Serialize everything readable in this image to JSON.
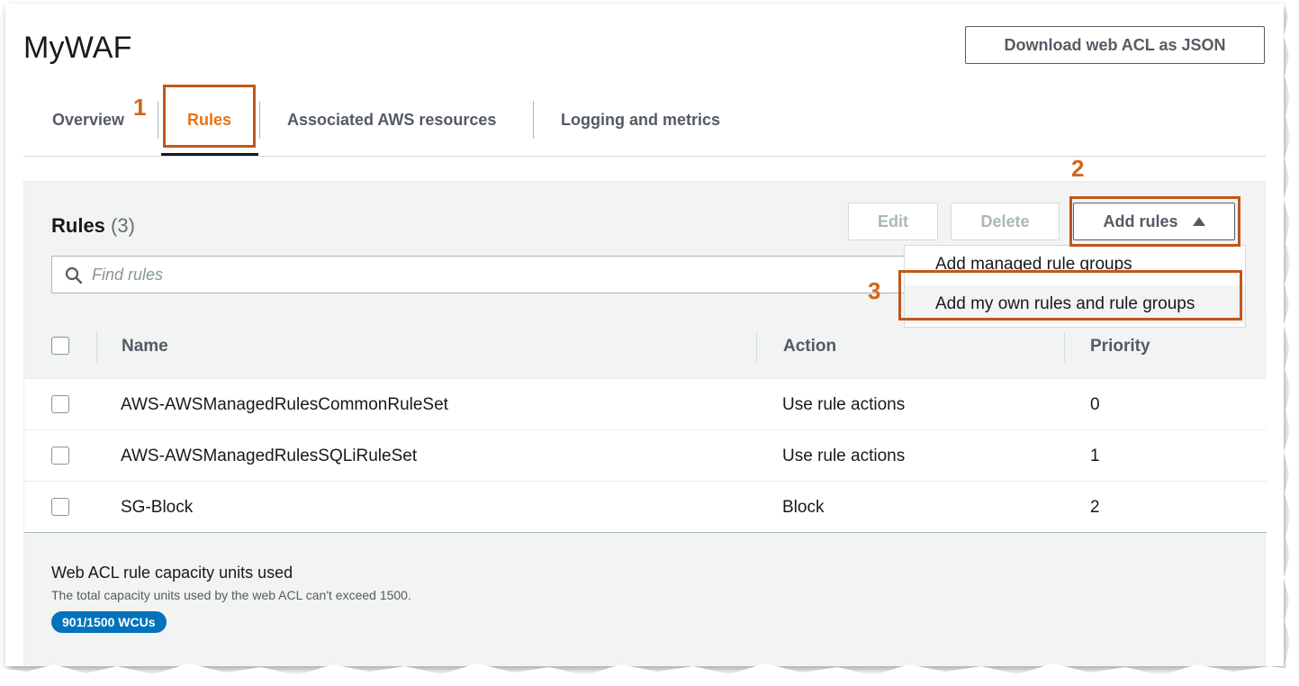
{
  "header": {
    "title": "MyWAF",
    "download_button": "Download web ACL as JSON"
  },
  "tabs": [
    {
      "label": "Overview"
    },
    {
      "label": "Rules"
    },
    {
      "label": "Associated AWS resources"
    },
    {
      "label": "Logging and metrics"
    }
  ],
  "active_tab": "Rules",
  "callouts": [
    "1",
    "2",
    "3"
  ],
  "rules_panel": {
    "heading": "Rules",
    "count": "(3)",
    "edit_button": "Edit",
    "delete_button": "Delete",
    "add_rules_button": "Add rules",
    "search_placeholder": "Find rules",
    "dropdown": [
      {
        "label": "Add managed rule groups"
      },
      {
        "label": "Add my own rules and rule groups"
      }
    ],
    "columns": [
      "Name",
      "Action",
      "Priority"
    ],
    "rows": [
      {
        "name": "AWS-AWSManagedRulesCommonRuleSet",
        "action": "Use rule actions",
        "priority": "0"
      },
      {
        "name": "AWS-AWSManagedRulesSQLiRuleSet",
        "action": "Use rule actions",
        "priority": "1"
      },
      {
        "name": "SG-Block",
        "action": "Block",
        "priority": "2"
      }
    ]
  },
  "capacity": {
    "title": "Web ACL rule capacity units used",
    "description": "The total capacity units used by the web ACL can't exceed 1500.",
    "badge": "901/1500 WCUs"
  },
  "colors": {
    "accent_orange": "#ec7211",
    "callout_border": "#c0571a",
    "badge_blue": "#0073bb"
  }
}
